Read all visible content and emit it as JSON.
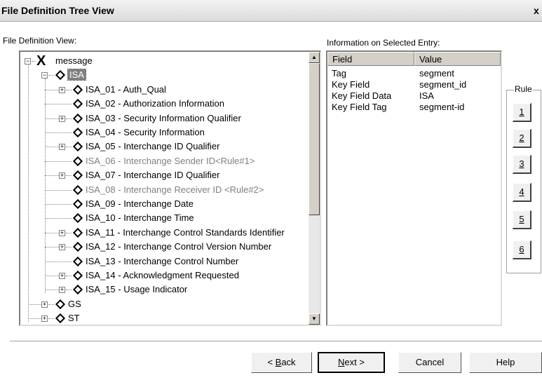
{
  "window": {
    "title": "File Definition Tree View",
    "close_glyph": "x"
  },
  "tree_panel": {
    "label": "File Definition View:",
    "root": {
      "label": "message",
      "icon": "x-icon"
    },
    "isa": {
      "label": "ISA",
      "icon": "diamond-icon"
    },
    "children": [
      {
        "label": "ISA_01 - Auth_Qual",
        "expandable": true,
        "grey": false
      },
      {
        "label": "ISA_02 - Authorization Information",
        "expandable": false,
        "grey": false
      },
      {
        "label": "ISA_03 - Security Information Qualifier",
        "expandable": true,
        "grey": false
      },
      {
        "label": "ISA_04 - Security Information",
        "expandable": false,
        "grey": false
      },
      {
        "label": "ISA_05 - Interchange ID Qualifier",
        "expandable": true,
        "grey": false
      },
      {
        "label": "ISA_06 - Interchange Sender ID<Rule#1>",
        "expandable": false,
        "grey": true
      },
      {
        "label": "ISA_07 - Interchange ID Qualifier",
        "expandable": true,
        "grey": false
      },
      {
        "label": "ISA_08 - Interchange Receiver ID <Rule#2>",
        "expandable": false,
        "grey": true
      },
      {
        "label": "ISA_09 - Interchange Date",
        "expandable": false,
        "grey": false
      },
      {
        "label": "ISA_10 - Interchange Time",
        "expandable": false,
        "grey": false
      },
      {
        "label": "ISA_11 - Interchange Control Standards Identifier",
        "expandable": true,
        "grey": false
      },
      {
        "label": "ISA_12 - Interchange Control Version Number",
        "expandable": true,
        "grey": false
      },
      {
        "label": "ISA_13 - Interchange Control Number",
        "expandable": false,
        "grey": false
      },
      {
        "label": "ISA_14 - Acknowledgment Requested",
        "expandable": true,
        "grey": false
      },
      {
        "label": "ISA_15 - Usage Indicator",
        "expandable": true,
        "grey": false
      }
    ],
    "siblings": [
      {
        "label": "GS"
      },
      {
        "label": "ST"
      }
    ]
  },
  "info_panel": {
    "label": "Information on Selected Entry:",
    "columns": [
      "Field",
      "Value"
    ],
    "rows": [
      [
        "Tag",
        "segment"
      ],
      [
        "Key Field",
        "segment_id"
      ],
      [
        "Key Field Data",
        "ISA"
      ],
      [
        "Key Field Tag",
        "segment-id"
      ]
    ]
  },
  "rules": {
    "legend": "Rule",
    "buttons": [
      "1",
      "2",
      "3",
      "4",
      "5",
      "6"
    ]
  },
  "footer": {
    "back_prefix": "< ",
    "back_key": "B",
    "back_rest": "ack",
    "next_key": "N",
    "next_rest": "ext >",
    "cancel": "Cancel",
    "help": "Help"
  }
}
